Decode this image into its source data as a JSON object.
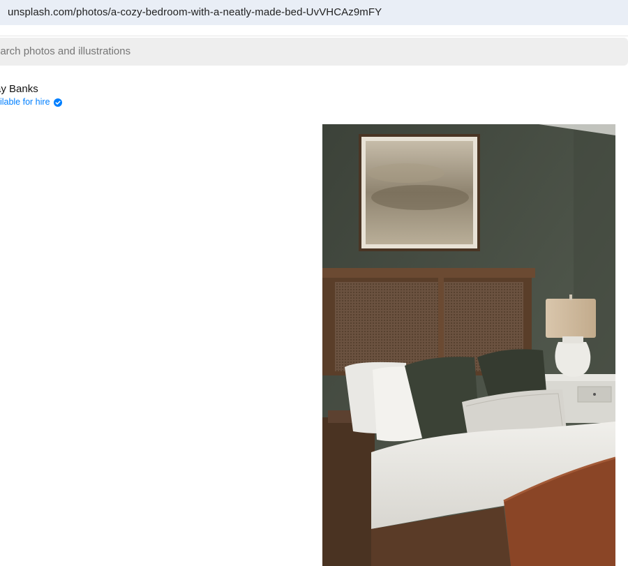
{
  "browser": {
    "url": "unsplash.com/photos/a-cozy-bedroom-with-a-neatly-made-bed-UvVHCAz9mFY"
  },
  "search": {
    "placeholder": "earch photos and illustrations"
  },
  "author": {
    "name": "ay Banks",
    "hire_label": "ailable for hire"
  },
  "colors": {
    "wall": "#4a5147",
    "hire_blue": "#007fff",
    "headboard": "#6b4a32",
    "pillow_green": "#3b4236",
    "throw_rust": "#8a4526"
  },
  "icons": {
    "verified": "verified-badge-icon"
  }
}
